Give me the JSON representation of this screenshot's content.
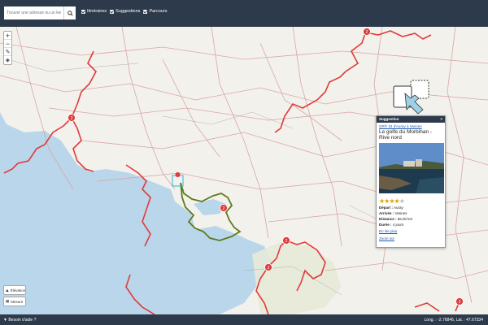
{
  "search": {
    "placeholder": "Trouver une adresse ou un lieu"
  },
  "filters": [
    {
      "label": "Itinéraires",
      "checked": true
    },
    {
      "label": "Suggestions",
      "checked": true
    },
    {
      "label": "Parcours",
      "checked": true
    }
  ],
  "map_controls": {
    "zoom_in": "+",
    "zoom_out": "−"
  },
  "side_buttons": {
    "elevation": "Élévation",
    "measure": "Mesure"
  },
  "cluster_badges": [
    "2",
    "2",
    "2",
    "2",
    "2",
    "2"
  ],
  "popup": {
    "header": "Suggestion",
    "close": "×",
    "link": "GR® 34 d'Auray à Vannes",
    "title": "Le golfe du Morbihan - Rive nord",
    "rating": 4,
    "rating_max": 5,
    "rows": [
      {
        "label": "Départ :",
        "value": "Auray"
      },
      {
        "label": "Arrivée :",
        "value": "Vannes"
      },
      {
        "label": "Distance :",
        "value": "66,00 km"
      },
      {
        "label": "Durée :",
        "value": "4 jours"
      }
    ],
    "more": "En lire plus",
    "zoom": "Zoom sur"
  },
  "statusbar": {
    "help": "Besoin d'aide ?",
    "coords": "Long. : -2.76846, Lat. : 47.67334"
  },
  "colors": {
    "topbar": "#2d3a4b",
    "sea": "#b9d6ea",
    "trail_red": "#e03b3b",
    "trail_green": "#5d7a1f",
    "road": "#d28a8a"
  }
}
